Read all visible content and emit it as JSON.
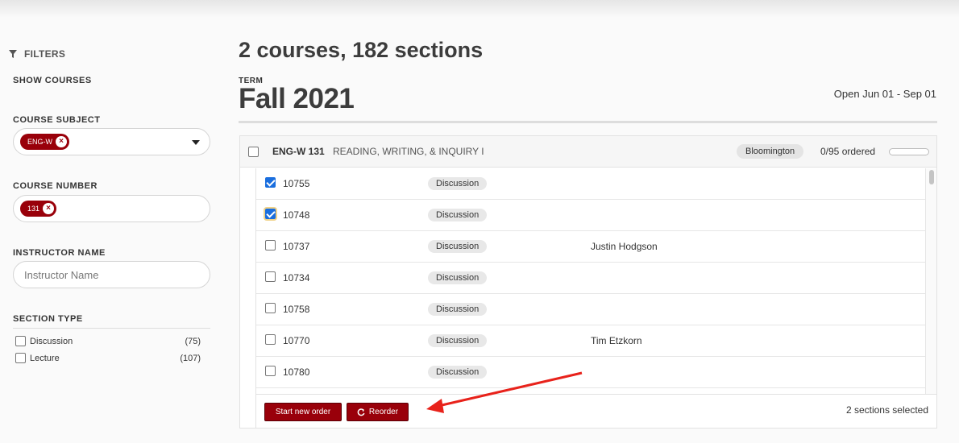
{
  "sidebar": {
    "filters_label": "FILTERS",
    "show_courses_label": "SHOW COURSES",
    "course_subject": {
      "label": "COURSE SUBJECT",
      "tag": "ENG-W"
    },
    "course_number": {
      "label": "COURSE NUMBER",
      "tag": "131"
    },
    "instructor": {
      "label": "INSTRUCTOR NAME",
      "placeholder": "Instructor Name"
    },
    "section_type": {
      "label": "SECTION TYPE",
      "options": [
        {
          "label": "Discussion",
          "count": "(75)"
        },
        {
          "label": "Lecture",
          "count": "(107)"
        }
      ]
    }
  },
  "main": {
    "title": "2 courses, 182 sections",
    "term_label": "TERM",
    "term_name": "Fall 2021",
    "term_open": "Open Jun 01 - Sep 01",
    "course": {
      "code": "ENG-W 131",
      "name": "READING, WRITING, & INQUIRY I",
      "campus": "Bloomington",
      "ordered": "0/95 ordered",
      "ordered_fraction": 0
    },
    "sections": [
      {
        "number": "10755",
        "type": "Discussion",
        "instructor": "",
        "checked": true
      },
      {
        "number": "10748",
        "type": "Discussion",
        "instructor": "",
        "checked": true
      },
      {
        "number": "10737",
        "type": "Discussion",
        "instructor": "Justin Hodgson",
        "checked": false
      },
      {
        "number": "10734",
        "type": "Discussion",
        "instructor": "",
        "checked": false
      },
      {
        "number": "10758",
        "type": "Discussion",
        "instructor": "",
        "checked": false
      },
      {
        "number": "10770",
        "type": "Discussion",
        "instructor": "Tim Etzkorn",
        "checked": false
      },
      {
        "number": "10780",
        "type": "Discussion",
        "instructor": "",
        "checked": false
      },
      {
        "number": "",
        "type": "",
        "instructor": "",
        "checked": false
      }
    ],
    "footer": {
      "start_new_order": "Start new order",
      "reorder": "Reorder",
      "selected": "2 sections selected"
    }
  },
  "colors": {
    "accent": "#99000a",
    "checkbox": "#1a6ede",
    "annotation_arrow": "#e8221b"
  }
}
